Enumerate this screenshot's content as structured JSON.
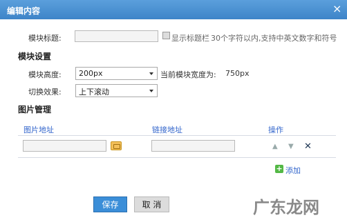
{
  "dialog": {
    "title": "编辑内容",
    "close_icon": "×"
  },
  "module_title": {
    "label": "模块标题:",
    "input_value": "",
    "checkbox_label": "显示标题栏",
    "hint": "30个字符以内,支持中英文数字和符号"
  },
  "module_settings": {
    "section": "模块设置",
    "height_label": "模块高度:",
    "height_value": "200px",
    "current_width_label": "当前模块宽度为:",
    "current_width_value": "750px",
    "effect_label": "切换效果:",
    "effect_value": "上下滚动"
  },
  "image_mgmt": {
    "section": "图片管理",
    "col_image": "图片地址",
    "col_link": "链接地址",
    "col_action": "操作",
    "row": {
      "image_value": "",
      "link_value": ""
    },
    "up_icon": "▲",
    "down_icon": "▼",
    "delete_icon": "✕",
    "add_icon": "+",
    "add_label": "添加"
  },
  "buttons": {
    "save": "保存",
    "cancel": "取 消"
  },
  "watermark": "广东龙网"
}
